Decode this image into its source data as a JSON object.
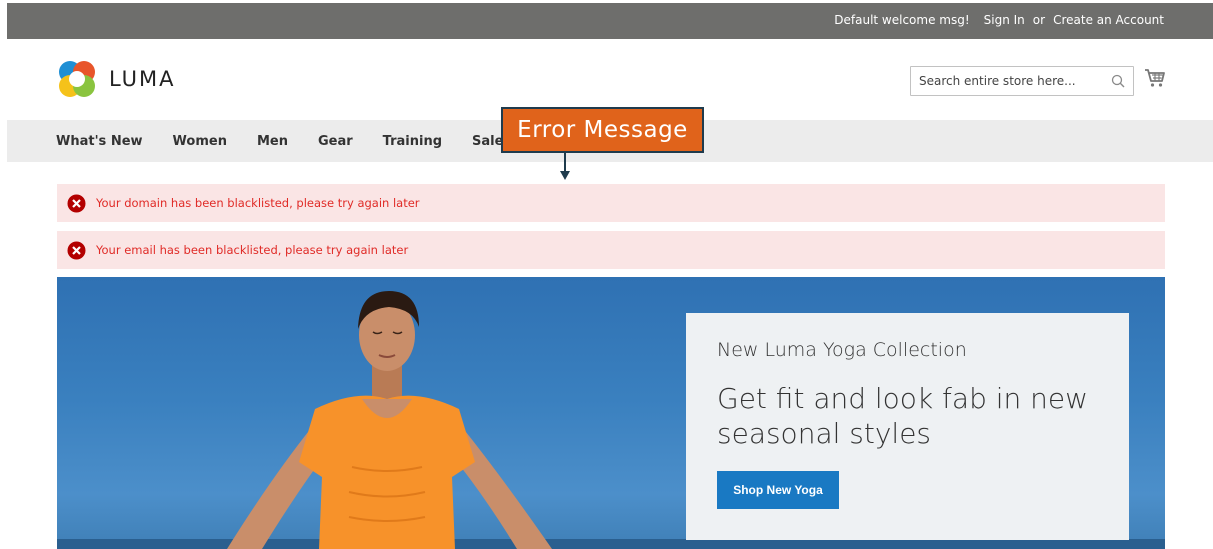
{
  "topbar": {
    "welcome": "Default welcome msg!",
    "sign_in": "Sign In",
    "or": "or",
    "create_account": "Create an Account"
  },
  "header": {
    "logo_text": "LUMA",
    "search_placeholder": "Search entire store here...",
    "search_icon": "search-icon",
    "cart_icon": "cart-icon"
  },
  "nav": {
    "items": [
      "What's New",
      "Women",
      "Men",
      "Gear",
      "Training",
      "Sale"
    ]
  },
  "annotation": {
    "label": "Error Message",
    "color": "#e0631b"
  },
  "messages": [
    {
      "text": "Your domain has been blacklisted, please try again later",
      "icon": "error-icon"
    },
    {
      "text": "Your email has been blacklisted, please try again later",
      "icon": "error-icon"
    }
  ],
  "hero": {
    "subtitle": "New Luma Yoga Collection",
    "title": "Get fit and look fab in new seasonal styles",
    "button_label": "Shop New Yoga"
  },
  "colors": {
    "topbar_bg": "#6e6e6c",
    "nav_bg": "#ececec",
    "error_bg": "#fae5e5",
    "error_text": "#e02b27",
    "button_bg": "#1979c3"
  }
}
